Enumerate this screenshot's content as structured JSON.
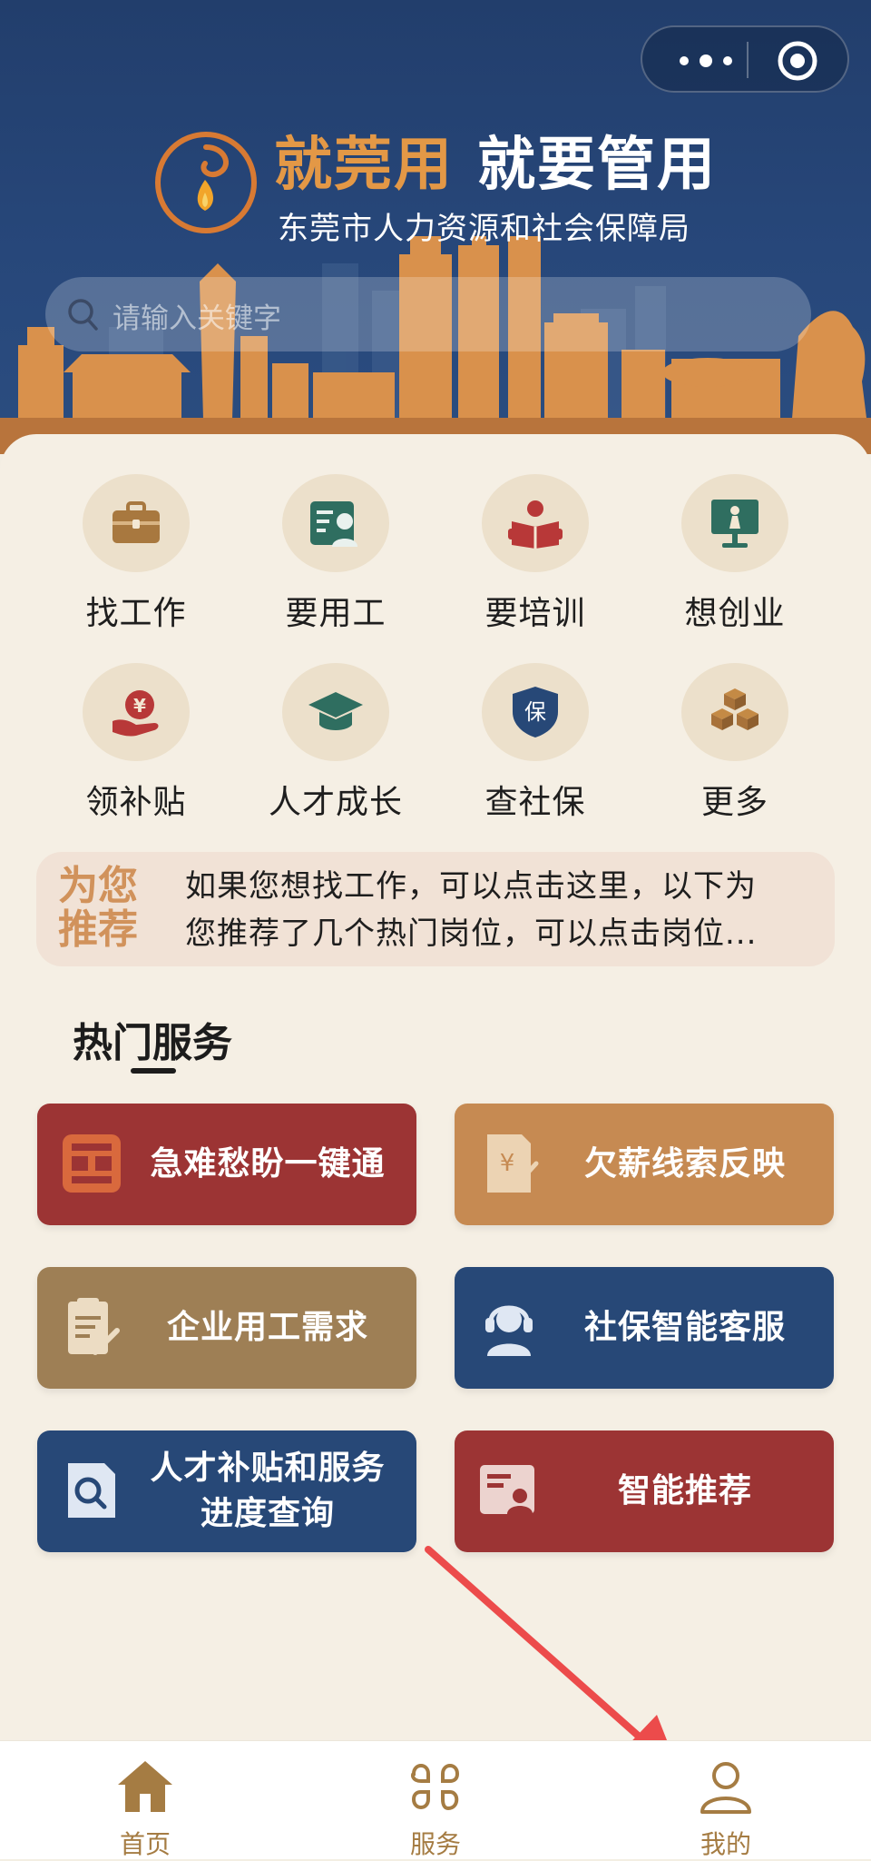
{
  "header": {
    "slogan_part1": "就莞用",
    "slogan_part2": "就要管用",
    "bureau": "东莞市人力资源和社会保障局"
  },
  "search": {
    "placeholder": "请输入关键字"
  },
  "quick_services": [
    {
      "label": "找工作",
      "icon": "briefcase-icon"
    },
    {
      "label": "要用工",
      "icon": "recruiter-icon"
    },
    {
      "label": "要培训",
      "icon": "reading-icon"
    },
    {
      "label": "想创业",
      "icon": "presentation-icon"
    },
    {
      "label": "领补贴",
      "icon": "subsidy-yuan-icon"
    },
    {
      "label": "人才成长",
      "icon": "graduation-cap-icon"
    },
    {
      "label": "查社保",
      "icon": "shield-bao-icon"
    },
    {
      "label": "更多",
      "icon": "cubes-icon"
    }
  ],
  "recommend": {
    "tag_line1": "为您",
    "tag_line2": "推荐",
    "text_line1": "如果您想找工作，可以点击这里，以下为",
    "text_line2": "您推荐了几个热门岗位，可以点击岗位..."
  },
  "hot_services": {
    "title": "热门服务",
    "items": [
      {
        "label": "急难愁盼一键通",
        "icon": "seal-icon",
        "color": "#9c3434"
      },
      {
        "label": "欠薪线索反映",
        "icon": "wage-document-icon",
        "color": "#c68a52"
      },
      {
        "label": "企业用工需求",
        "icon": "clipboard-edit-icon",
        "color": "#9e7f55"
      },
      {
        "label": "社保智能客服",
        "icon": "customer-service-icon",
        "color": "#274877"
      },
      {
        "label_line1": "人才补贴和服务",
        "label_line2": "进度查询",
        "icon": "search-document-icon",
        "color": "#274877"
      },
      {
        "label": "智能推荐",
        "icon": "recommend-card-icon",
        "color": "#9c3434"
      }
    ]
  },
  "tabbar": {
    "items": [
      {
        "label": "首页",
        "icon": "home-icon"
      },
      {
        "label": "服务",
        "icon": "services-grid-icon"
      },
      {
        "label": "我的",
        "icon": "user-icon"
      }
    ]
  },
  "colors": {
    "header_bg": "#223e6c",
    "accent_gold": "#a57c43",
    "red": "#9c3434",
    "navy": "#274877",
    "annotation_arrow": "#ec4b4b"
  }
}
